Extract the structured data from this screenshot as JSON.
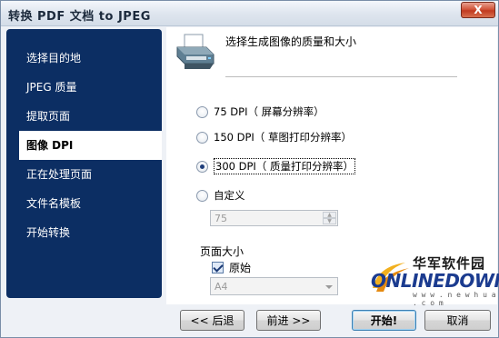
{
  "window": {
    "title": "转换 PDF 文档 to JPEG",
    "close_label": "X"
  },
  "nav": {
    "items": [
      {
        "label": "选择目的地"
      },
      {
        "label": "JPEG 质量"
      },
      {
        "label": "提取页面"
      },
      {
        "label": "图像 DPI",
        "active": true
      },
      {
        "label": "正在处理页面"
      },
      {
        "label": "文件名模板"
      },
      {
        "label": "开始转换"
      }
    ]
  },
  "header": {
    "title": "选择生成图像的质量和大小",
    "icon": "printer-icon"
  },
  "dpi_options": [
    {
      "label": "75 DPI（ 屏幕分辨率）",
      "checked": false
    },
    {
      "label": "150 DPI（ 草图打印分辨率）",
      "checked": false
    },
    {
      "label": "300 DPI（ 质量打印分辨率）",
      "checked": true
    },
    {
      "label": "自定义",
      "checked": false
    }
  ],
  "custom_dpi": {
    "value": "75"
  },
  "page_size": {
    "label": "页面大小",
    "original_label": "原始",
    "original_checked": true,
    "size_value": "A4"
  },
  "buttons": {
    "back": "<< 后退",
    "next": "前进 >>",
    "start": "开始!",
    "cancel": "取消"
  },
  "watermark": {
    "cn": "华军软件园",
    "brand": "ONLINEDOWN",
    "url": "w w w . n e w h u a . c o m"
  },
  "colors": {
    "nav_bg": "#0c2e63",
    "brand_blue": "#1b3b8f",
    "swoosh_yellow": "#f2b01e"
  }
}
